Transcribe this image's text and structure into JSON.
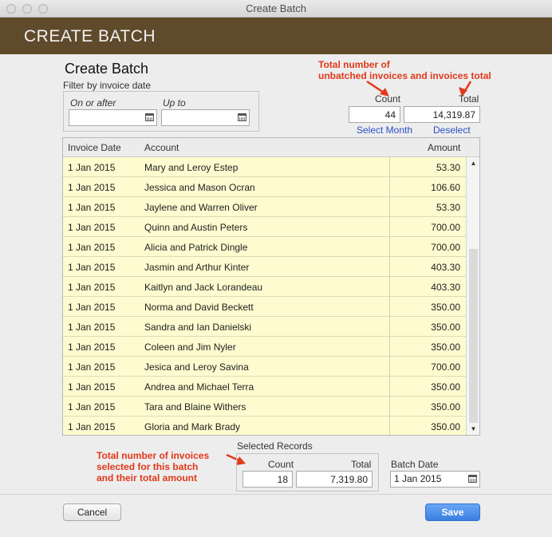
{
  "window": {
    "title": "Create Batch"
  },
  "banner": {
    "title": "CREATE BATCH"
  },
  "form": {
    "heading": "Create Batch",
    "filter_label": "Filter by invoice date",
    "on_or_after_label": "On or after",
    "up_to_label": "Up to",
    "on_or_after_value": "",
    "up_to_value": ""
  },
  "unbatched": {
    "annotation_line1": "Total number of",
    "annotation_line2": "unbatched invoices and invoices total",
    "count_label": "Count",
    "total_label": "Total",
    "count_value": "44",
    "total_value": "14,319.87",
    "select_month_link": "Select Month",
    "deselect_link": "Deselect"
  },
  "table": {
    "headers": {
      "date": "Invoice Date",
      "account": "Account",
      "amount": "Amount"
    },
    "rows": [
      {
        "date": "1 Jan 2015",
        "account": "Mary and Leroy Estep",
        "amount": "53.30"
      },
      {
        "date": "1 Jan 2015",
        "account": "Jessica and Mason Ocran",
        "amount": "106.60"
      },
      {
        "date": "1 Jan 2015",
        "account": "Jaylene and Warren Oliver",
        "amount": "53.30"
      },
      {
        "date": "1 Jan 2015",
        "account": "Quinn and Austin Peters",
        "amount": "700.00"
      },
      {
        "date": "1 Jan 2015",
        "account": "Alicia and Patrick Dingle",
        "amount": "700.00"
      },
      {
        "date": "1 Jan 2015",
        "account": "Jasmin and Arthur Kinter",
        "amount": "403.30"
      },
      {
        "date": "1 Jan 2015",
        "account": "Kaitlyn and Jack Lorandeau",
        "amount": "403.30"
      },
      {
        "date": "1 Jan 2015",
        "account": "Norma and David Beckett",
        "amount": "350.00"
      },
      {
        "date": "1 Jan 2015",
        "account": "Sandra and Ian Danielski",
        "amount": "350.00"
      },
      {
        "date": "1 Jan 2015",
        "account": "Coleen and Jim Nyler",
        "amount": "350.00"
      },
      {
        "date": "1 Jan 2015",
        "account": "Jesica and Leroy Savina",
        "amount": "700.00"
      },
      {
        "date": "1 Jan 2015",
        "account": "Andrea and Michael Terra",
        "amount": "350.00"
      },
      {
        "date": "1 Jan 2015",
        "account": "Tara and Blaine Withers",
        "amount": "350.00"
      },
      {
        "date": "1 Jan 2015",
        "account": "Gloria and Mark Brady",
        "amount": "350.00"
      }
    ]
  },
  "selected": {
    "title": "Selected Records",
    "annotation_line1": "Total number of invoices",
    "annotation_line2": "selected for this batch",
    "annotation_line3": "and their total amount",
    "count_label": "Count",
    "total_label": "Total",
    "count_value": "18",
    "total_value": "7,319.80"
  },
  "batch": {
    "date_label": "Batch Date",
    "date_value": "1 Jan 2015"
  },
  "buttons": {
    "cancel": "Cancel",
    "save": "Save"
  },
  "colors": {
    "banner": "#5f4a2b",
    "row_highlight": "#fdfbcf",
    "annotation": "#e2381c",
    "link": "#2a4fc8",
    "save_button": "#3a7fe0"
  },
  "icons": {
    "date_picker": "calendar-icon",
    "scroll_up": "scroll-up-arrow-icon",
    "scroll_down": "scroll-down-arrow-icon"
  }
}
